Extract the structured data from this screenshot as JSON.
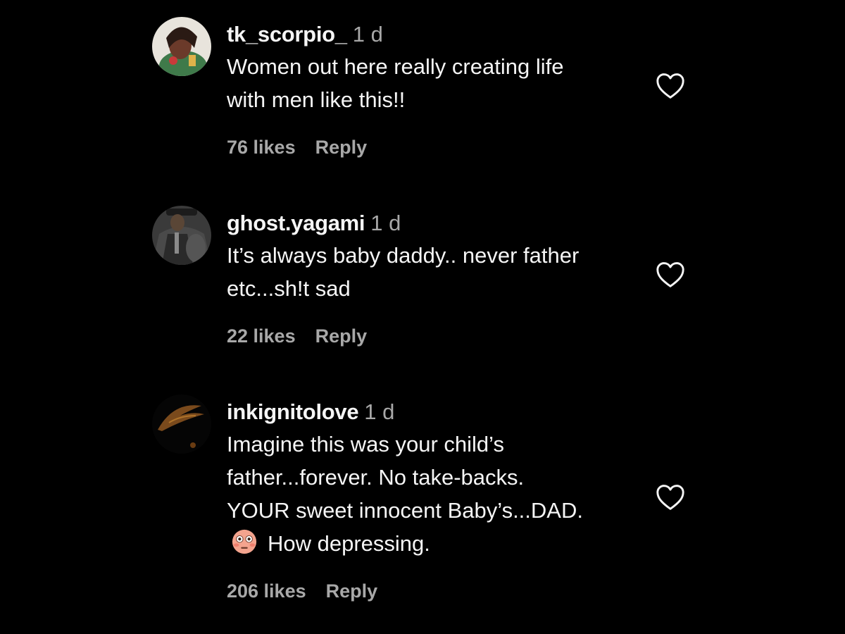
{
  "comments": [
    {
      "username": "tk_scorpio_",
      "time": "1 d",
      "lines": [
        "Women out here really creating life",
        "with men like this!!"
      ],
      "likes": "76 likes",
      "reply": "Reply",
      "like_icon": "heart-outline-icon"
    },
    {
      "username": "ghost.yagami",
      "time": "1 d",
      "lines": [
        "It’s always baby daddy.. never father",
        "etc...sh!t sad"
      ],
      "likes": "22 likes",
      "reply": "Reply",
      "like_icon": "heart-outline-icon"
    },
    {
      "username": "inkignitolove",
      "time": "1 d",
      "lines": [
        "Imagine this was your child’s",
        "father...forever. No take-backs.",
        "YOUR sweet innocent Baby’s...DAD."
      ],
      "last_line": "How depressing.",
      "emoji_icon": "flushed-face-emoji-icon",
      "likes": "206 likes",
      "reply": "Reply",
      "like_icon": "heart-outline-icon"
    }
  ],
  "colors": {
    "background": "#000000",
    "text": "#f5f5f5",
    "muted": "#a8a8a8"
  }
}
